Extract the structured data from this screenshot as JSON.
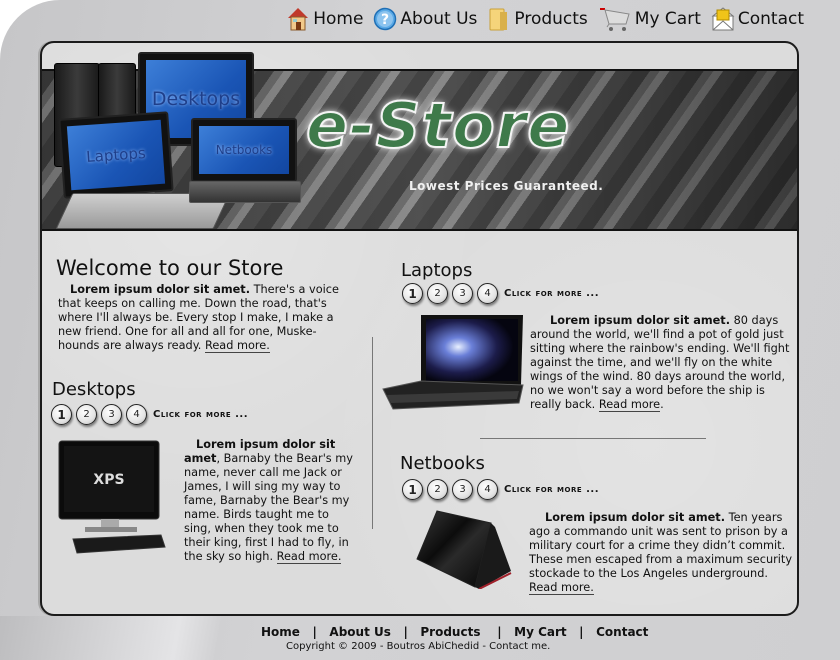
{
  "nav": {
    "items": [
      {
        "label": "Home",
        "icon": "home-icon"
      },
      {
        "label": "About Us",
        "icon": "help-icon"
      },
      {
        "label": "Products",
        "icon": "folder-icon"
      },
      {
        "label": "My Cart",
        "icon": "cart-icon"
      },
      {
        "label": "Contact",
        "icon": "envelope-icon"
      }
    ]
  },
  "banner": {
    "logo": "e-Store",
    "tagline": "Lowest Prices Guaranteed.",
    "device_labels": {
      "desktops": "Desktops",
      "laptops": "Laptops",
      "netbooks": "Netbooks"
    }
  },
  "welcome": {
    "title": "Welcome to our Store",
    "lead": "Lorem ipsum dolor sit amet.",
    "body": " There's a voice that keeps on calling me. Down the road, that's where I'll always be. Every stop I make, I make a new friend.  One for all and all for one, Muske-hounds are always ready.  ",
    "read_more": "Read more."
  },
  "sections": {
    "desktops": {
      "title": "Desktops",
      "pages": [
        "1",
        "2",
        "3",
        "4"
      ],
      "active_page": "1",
      "more": "Click for more ...",
      "lead": "Lorem ipsum dolor sit amet",
      "body": ", Barnaby the Bear's my name, never call me Jack or James, I will sing my way to fame, Barnaby the Bear's my name. Birds taught me to sing, when they took me to their king, first I had to fly, in the sky so high.  ",
      "read_more": "Read more."
    },
    "laptops": {
      "title": "Laptops",
      "pages": [
        "1",
        "2",
        "3",
        "4"
      ],
      "active_page": "1",
      "more": "Click for more ...",
      "lead": "Lorem ipsum dolor sit amet.",
      "body": " 80 days around the world, we'll find a pot of gold just sitting where the rainbow's ending. We'll fight against the time, and we'll fly on the white wings of the wind. 80 days around the world, no we won't say a word before the ship is really back.  ",
      "read_more": "Read more",
      "read_more_suffix": "."
    },
    "netbooks": {
      "title": "Netbooks",
      "pages": [
        "1",
        "2",
        "3",
        "4"
      ],
      "active_page": "1",
      "more": "Click for more ...",
      "lead": "Lorem ipsum dolor sit amet.",
      "body": " Ten years ago a commando unit was sent to prison by a military court for a crime they didn’t commit. These men escaped from a maximum security stockade to the Los Angeles underground.",
      "read_more": "Read more."
    }
  },
  "footer": {
    "links": [
      "Home",
      "About Us",
      "Products",
      "My Cart",
      "Contact"
    ],
    "separator": "|",
    "copyright": "Copyright © 2009 - Boutros  AbiChedid - Contact me."
  },
  "colors": {
    "frame": "#cfcfd1",
    "panel": "#dcdcdc",
    "border": "#1b1b1b",
    "logo_green": "#3e7a4a"
  }
}
